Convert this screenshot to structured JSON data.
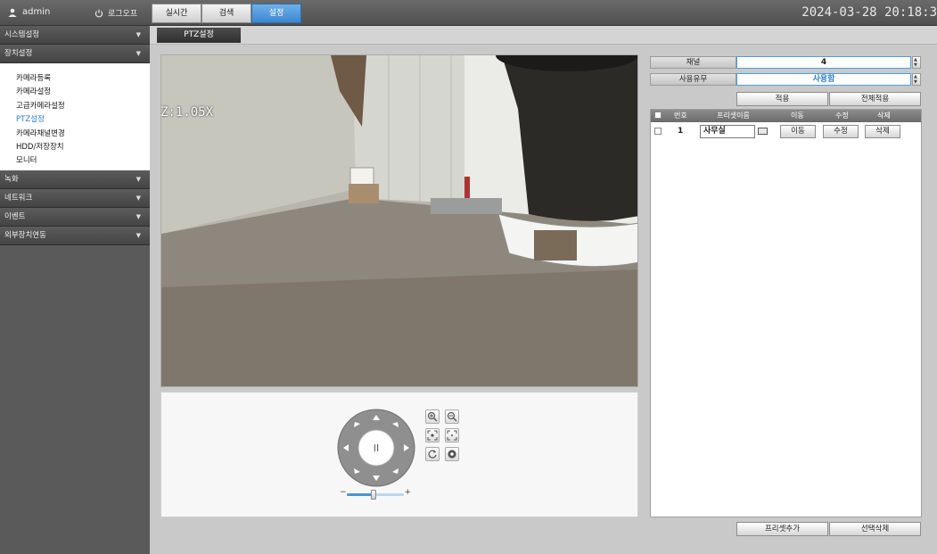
{
  "topbar": {
    "username": "admin",
    "logout_label": "로그오프",
    "tabs": [
      "실시간",
      "검색",
      "설정"
    ],
    "active_tab": "설정",
    "datetime": "2024-03-28 20:18:3"
  },
  "sidebar": {
    "sections": [
      {
        "label": "시스템설정"
      },
      {
        "label": "장치설정"
      },
      {
        "label": "녹화"
      },
      {
        "label": "네트워크"
      },
      {
        "label": "이벤트"
      },
      {
        "label": "외부장치연동"
      }
    ],
    "device_items": [
      "카메라등록",
      "카메라설정",
      "고급카메라설정",
      "PTZ설정",
      "카메라채널변경",
      "HDD/저장장치",
      "모니터"
    ],
    "active_item": "PTZ설정"
  },
  "main": {
    "subtab": "PTZ설정",
    "zoom_overlay": "Z:1.05X"
  },
  "ptz": {
    "pause_symbol": "II",
    "speed_minus": "−",
    "speed_plus": "+",
    "speed_level": 0.47
  },
  "settings": {
    "channel_label": "채널",
    "channel_value": "4",
    "usage_label": "사용유무",
    "usage_value": "사용함",
    "apply_label": "적용",
    "apply_all_label": "전체적용"
  },
  "preset_table": {
    "columns": [
      "번호",
      "프리셋이름",
      "이동",
      "수정",
      "삭제"
    ],
    "rows": [
      {
        "number": "1",
        "name": "사무실",
        "move": "이동",
        "edit": "수정",
        "delete": "삭제"
      }
    ]
  },
  "footer_buttons": {
    "add_preset": "프리셋추가",
    "delete_selected": "선택삭제"
  },
  "colors": {
    "accent": "#3d87cf",
    "active_text": "#2b7ec9",
    "usage_value_text": "#2b7ec9"
  }
}
